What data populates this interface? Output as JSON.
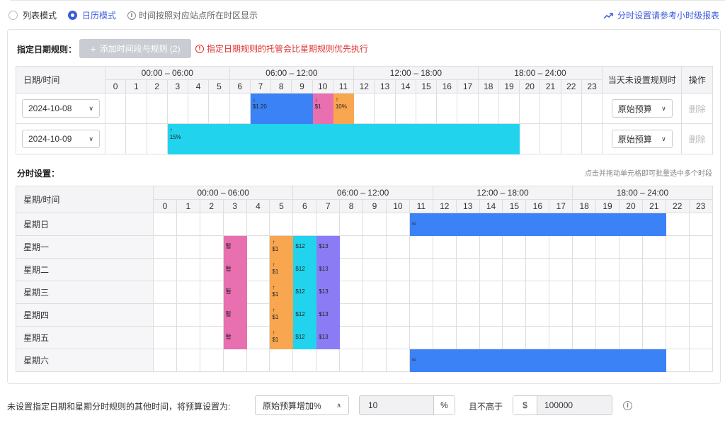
{
  "topbar": {
    "list_mode": "列表模式",
    "calendar_mode": "日历模式",
    "hint": "时间按照对应站点所在时区显示",
    "report_link": "分时设置请参考小时级报表"
  },
  "date_rules": {
    "title": "指定日期规则：",
    "add_button": "添加时间段与规则 (2)",
    "warning": "指定日期规则的托管会比星期规则优先执行",
    "header_first": "日期/时间",
    "header_unset": "当天未设置规则时",
    "header_ops": "操作",
    "groups": [
      "00:00 – 06:00",
      "06:00 – 12:00",
      "12:00 – 18:00",
      "18:00 – 24:00"
    ],
    "hours": [
      "0",
      "1",
      "2",
      "3",
      "4",
      "5",
      "6",
      "7",
      "8",
      "9",
      "10",
      "11",
      "12",
      "13",
      "14",
      "15",
      "16",
      "17",
      "18",
      "19",
      "20",
      "21",
      "22",
      "23"
    ],
    "rows": [
      {
        "date": "2024-10-08",
        "unset": "原始预算",
        "delete": "删除",
        "segments": [
          {
            "start": 7,
            "end": 9,
            "color": "#3b82f6",
            "arrow": "↓",
            "label": "$1.20"
          },
          {
            "start": 10,
            "end": 10,
            "color": "#e86fb0",
            "arrow": "↓",
            "label": "$1"
          },
          {
            "start": 11,
            "end": 11,
            "color": "#f8a64f",
            "arrow": "↑",
            "label": "10%"
          }
        ]
      },
      {
        "date": "2024-10-09",
        "unset": "原始预算",
        "delete": "删除",
        "segments": [
          {
            "start": 3,
            "end": 19,
            "color": "#22d3ee",
            "arrow": "↑",
            "label": "15%"
          }
        ]
      }
    ]
  },
  "weekly": {
    "title": "分时设置：",
    "hint": "点击并拖动单元格即可批量选中多个时段",
    "header_first": "星期/时间",
    "groups": [
      "00:00 – 06:00",
      "06:00 – 12:00",
      "12:00 – 18:00",
      "18:00 – 24:00"
    ],
    "hours": [
      "0",
      "1",
      "2",
      "3",
      "4",
      "5",
      "6",
      "7",
      "8",
      "9",
      "10",
      "11",
      "12",
      "13",
      "14",
      "15",
      "16",
      "17",
      "18",
      "19",
      "20",
      "21",
      "22",
      "23"
    ],
    "rows": [
      {
        "day": "星期日",
        "segments": [
          {
            "start": 11,
            "end": 21,
            "color": "#3b82f6",
            "arrow": "",
            "label": "∞"
          }
        ]
      },
      {
        "day": "星期一",
        "segments": [
          {
            "start": 3,
            "end": 3,
            "color": "#e86fb0",
            "arrow": "",
            "label": "暂"
          },
          {
            "start": 5,
            "end": 5,
            "color": "#f8a64f",
            "arrow": "↑",
            "label": "$1"
          },
          {
            "start": 6,
            "end": 6,
            "color": "#22d3ee",
            "arrow": "",
            "label": "$12"
          },
          {
            "start": 7,
            "end": 7,
            "color": "#8b7cf6",
            "arrow": "",
            "label": "$13"
          }
        ]
      },
      {
        "day": "星期二",
        "segments": [
          {
            "start": 3,
            "end": 3,
            "color": "#e86fb0",
            "arrow": "",
            "label": "暂"
          },
          {
            "start": 5,
            "end": 5,
            "color": "#f8a64f",
            "arrow": "↑",
            "label": "$1"
          },
          {
            "start": 6,
            "end": 6,
            "color": "#22d3ee",
            "arrow": "",
            "label": "$12"
          },
          {
            "start": 7,
            "end": 7,
            "color": "#8b7cf6",
            "arrow": "",
            "label": "$13"
          }
        ]
      },
      {
        "day": "星期三",
        "segments": [
          {
            "start": 3,
            "end": 3,
            "color": "#e86fb0",
            "arrow": "",
            "label": "暂"
          },
          {
            "start": 5,
            "end": 5,
            "color": "#f8a64f",
            "arrow": "↑",
            "label": "$1"
          },
          {
            "start": 6,
            "end": 6,
            "color": "#22d3ee",
            "arrow": "",
            "label": "$12"
          },
          {
            "start": 7,
            "end": 7,
            "color": "#8b7cf6",
            "arrow": "",
            "label": "$13"
          }
        ]
      },
      {
        "day": "星期四",
        "segments": [
          {
            "start": 3,
            "end": 3,
            "color": "#e86fb0",
            "arrow": "",
            "label": "暂"
          },
          {
            "start": 5,
            "end": 5,
            "color": "#f8a64f",
            "arrow": "↑",
            "label": "$1"
          },
          {
            "start": 6,
            "end": 6,
            "color": "#22d3ee",
            "arrow": "",
            "label": "$12"
          },
          {
            "start": 7,
            "end": 7,
            "color": "#8b7cf6",
            "arrow": "",
            "label": "$13"
          }
        ]
      },
      {
        "day": "星期五",
        "segments": [
          {
            "start": 3,
            "end": 3,
            "color": "#e86fb0",
            "arrow": "",
            "label": "暂"
          },
          {
            "start": 5,
            "end": 5,
            "color": "#f8a64f",
            "arrow": "↑",
            "label": "$1"
          },
          {
            "start": 6,
            "end": 6,
            "color": "#22d3ee",
            "arrow": "",
            "label": "$12"
          },
          {
            "start": 7,
            "end": 7,
            "color": "#8b7cf6",
            "arrow": "",
            "label": "$13"
          }
        ]
      },
      {
        "day": "星期六",
        "segments": [
          {
            "start": 11,
            "end": 21,
            "color": "#3b82f6",
            "arrow": "",
            "label": "∞"
          }
        ]
      }
    ]
  },
  "footer": {
    "text": "未设置指定日期和星期分时规则的其他时间，将预算设置为:",
    "mode": "原始预算增加%",
    "value": "10",
    "unit": "%",
    "and_not_above": "且不高于",
    "currency": "$",
    "cap": "100000"
  },
  "colors": {
    "accent": "#3b5bdb",
    "warn": "#e03131"
  }
}
